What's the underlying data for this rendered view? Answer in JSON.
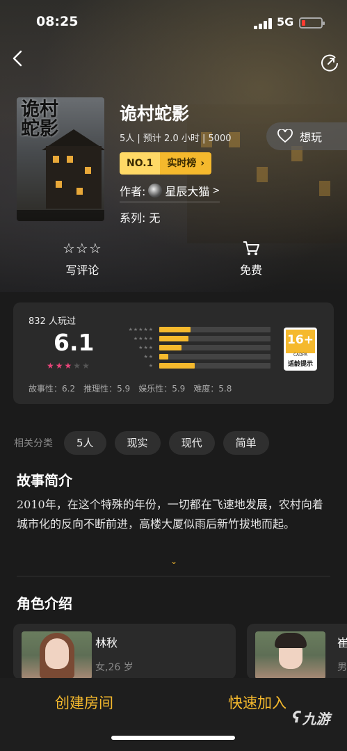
{
  "status_bar": {
    "time": "08:25",
    "network": "5G"
  },
  "game": {
    "title": "诡村蛇影",
    "cover_text": "诡村\n蛇影",
    "meta": "5人 | 预计 2.0 小时 | 5000",
    "rank_no": "NO.1",
    "rank_label": "实时榜",
    "author_prefix": "作者:",
    "author_name": "星辰大猫",
    "author_arrow": ">",
    "series": "系列: 无",
    "want_label": "想玩"
  },
  "actions": {
    "review_label": "写评论",
    "free_label": "免费"
  },
  "rating": {
    "plays_text": "832 人玩过",
    "score": "6.1",
    "stars_filled": 3,
    "stars_total": 5,
    "distribution": [
      {
        "stars": "★★★★★",
        "fraction": 0.28
      },
      {
        "stars": "★★★★",
        "fraction": 0.26
      },
      {
        "stars": "★★★",
        "fraction": 0.2
      },
      {
        "stars": "★★",
        "fraction": 0.08
      },
      {
        "stars": "★",
        "fraction": 0.32
      }
    ],
    "sub_scores": [
      "故事性：6.2",
      "推理性：5.9",
      "娱乐性：5.9",
      "难度：5.8"
    ],
    "age_badge": {
      "age": "16+",
      "org": "CADPA",
      "label": "适龄提示"
    }
  },
  "tags": {
    "label": "相关分类",
    "items": [
      "5人",
      "现实",
      "现代",
      "简单"
    ]
  },
  "synopsis": {
    "title": "故事简介",
    "text": "2010年，在这个特殊的年份，一切都在飞速地发展，农村向着城市化的反向不断前进，高楼大厦似雨后新竹拔地而起。"
  },
  "characters": {
    "title": "角色介绍",
    "items": [
      {
        "name": "林秋",
        "info": "女,26 岁"
      },
      {
        "name": "崔",
        "info": "男"
      }
    ]
  },
  "bottom": {
    "create_room": "创建房间",
    "quick_join": "快速加入"
  },
  "watermark": "九游",
  "colors": {
    "accent": "#f5b92d",
    "background": "#1b1b1b",
    "card": "#2a2a2a",
    "star_pink": "#e8457a"
  }
}
